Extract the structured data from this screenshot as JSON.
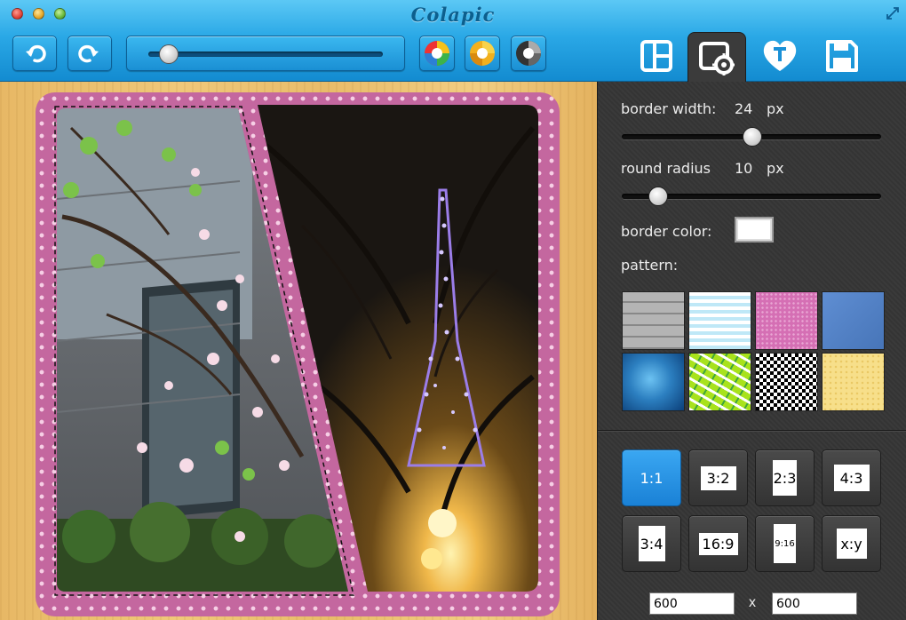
{
  "app": {
    "title": "Colapic"
  },
  "toolbar": {
    "undo_icon": "undo-arrow-icon",
    "redo_icon": "redo-arrow-icon",
    "zoom_slider_value": 0.08,
    "filters": [
      "color-filter-icon",
      "warm-filter-icon",
      "mono-filter-icon"
    ],
    "modes": [
      "layout-icon",
      "settings-gear-icon",
      "text-heart-icon",
      "save-disk-icon"
    ],
    "active_mode": "settings"
  },
  "settings": {
    "border_width_label": "border width:",
    "border_width_value": "24",
    "border_width_unit": "px",
    "border_width_slider": 0.5,
    "round_radius_label": "round radius",
    "round_radius_value": "10",
    "round_radius_unit": "px",
    "round_radius_slider": 0.13,
    "border_color_label": "border color:",
    "border_color_value": "#ffffff",
    "pattern_label": "pattern:",
    "patterns": [
      "bricks",
      "light-blue-stripes",
      "pink-hearts",
      "blue-denim",
      "blue-glow",
      "green-leaves",
      "black-white-check",
      "yellow-dots"
    ],
    "selected_pattern": "pink-hearts"
  },
  "ratios": {
    "options": [
      "1:1",
      "3:2",
      "2:3",
      "4:3",
      "3:4",
      "16:9",
      "9:16",
      "x:y"
    ],
    "active": "1:1"
  },
  "size": {
    "width": "600",
    "separator": "x",
    "height": "600"
  },
  "colors": {
    "toolbar_accent": "#2aa8e6",
    "border_pattern": "#c4679f",
    "active_ratio": "#2a94e4"
  }
}
